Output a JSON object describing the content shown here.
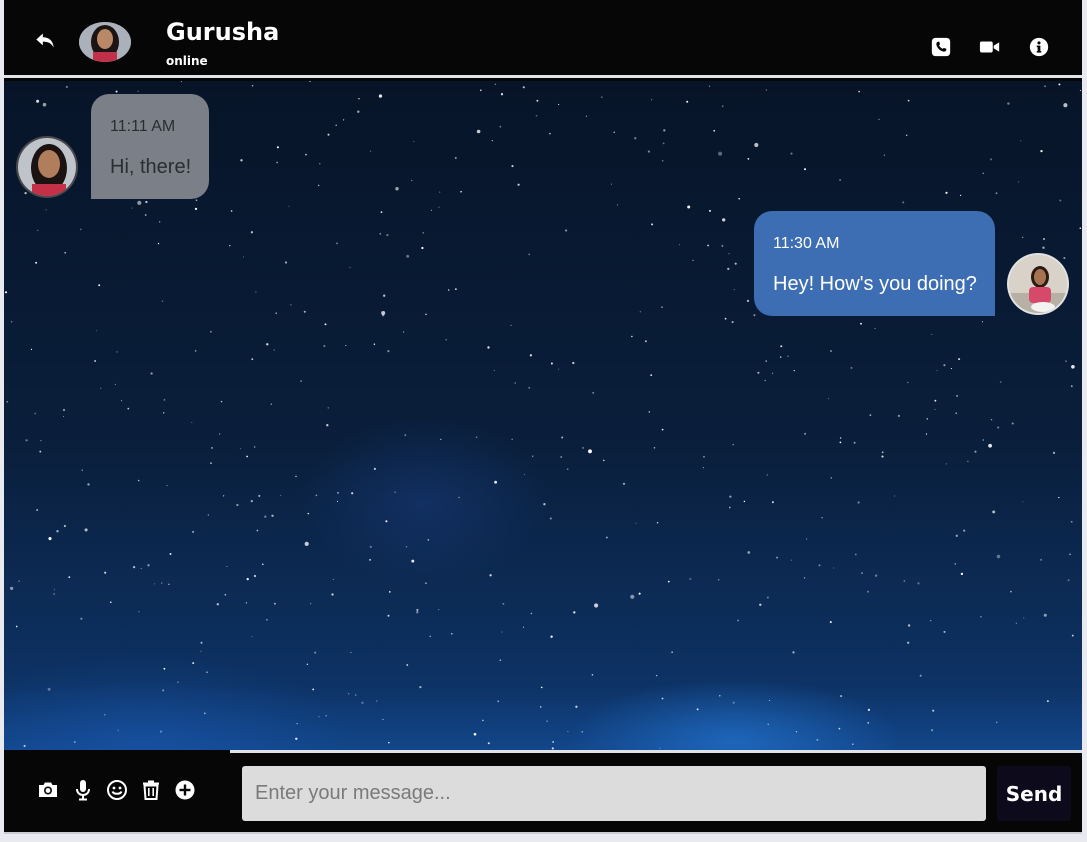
{
  "header": {
    "contact_name": "Gurusha",
    "status": "online",
    "back_icon": "reply-arrow-icon",
    "actions": [
      "phone-icon",
      "video-camera-icon",
      "info-icon"
    ]
  },
  "messages": [
    {
      "direction": "incoming",
      "time": "11:11 AM",
      "text": "Hi, there!"
    },
    {
      "direction": "outgoing",
      "time": "11:30 AM",
      "text": "Hey! How's you doing?"
    }
  ],
  "toolbar": {
    "icons": [
      "camera-icon",
      "microphone-icon",
      "smiley-icon",
      "trash-icon",
      "plus-circle-icon"
    ]
  },
  "composer": {
    "placeholder": "Enter your message...",
    "value": "",
    "send_label": "Send"
  },
  "colors": {
    "header_bg": "#060606",
    "incoming_bubble": "#7b7f87",
    "outgoing_bubble": "#3d6db2",
    "input_bg": "#dcdcdc",
    "send_bg": "#0d0a1c"
  }
}
